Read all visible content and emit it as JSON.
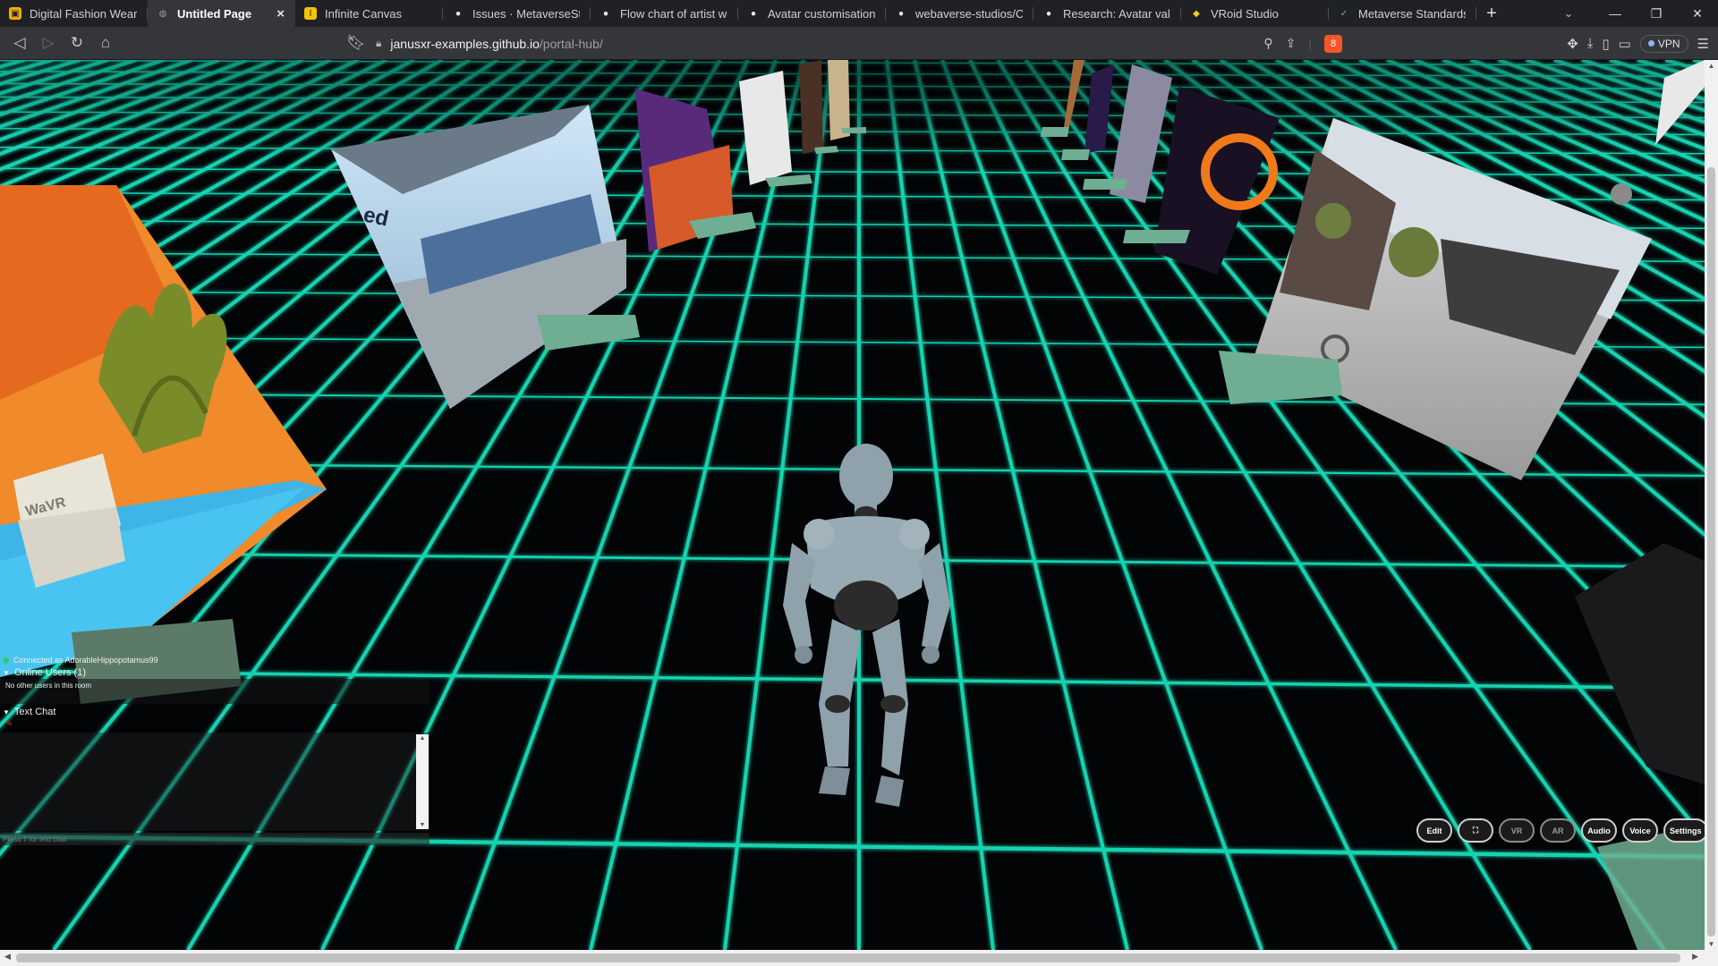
{
  "browser": {
    "tabs": [
      {
        "title": "Digital Fashion Wearabl",
        "icon": "bookmark-app-icon",
        "color": "#f9ab00",
        "active": false
      },
      {
        "title": "Untitled Page",
        "icon": "globe-icon",
        "color": "#9aa0a6",
        "active": true
      },
      {
        "title": "Infinite Canvas",
        "icon": "canvas-icon",
        "color": "#f4c20d",
        "active": false
      },
      {
        "title": "Issues · MetaverseStand",
        "icon": "github-icon",
        "color": "#ffffff",
        "active": false
      },
      {
        "title": "Flow chart of artist work",
        "icon": "github-icon",
        "color": "#ffffff",
        "active": false
      },
      {
        "title": "Avatar customisation: us",
        "icon": "github-icon",
        "color": "#ffffff",
        "active": false
      },
      {
        "title": "webaverse-studios/Char",
        "icon": "github-icon",
        "color": "#ffffff",
        "active": false
      },
      {
        "title": "Research: Avatar validati",
        "icon": "github-icon",
        "color": "#ffffff",
        "active": false
      },
      {
        "title": "VRoid Studio",
        "icon": "vroid-icon",
        "color": "#f7d20f",
        "active": false
      },
      {
        "title": "Metaverse Standards Fo",
        "icon": "msf-icon",
        "color": "#7cc142",
        "active": false
      }
    ],
    "new_tab": "+",
    "tab_close": "×",
    "url_host": "janusxr-examples.github.io",
    "url_path": "/portal-hub/",
    "vpn_label": "VPN",
    "shield_badge": "8"
  },
  "overlay": {
    "status_text": "Connected as AdorableHippopotamus99",
    "online_users_label": "Online Users (1)",
    "no_users_text": "No other users in this room",
    "text_chat_label": "Text Chat",
    "chat_placeholder": "Press T for text chat"
  },
  "scene_labels": {
    "portal_partial_text": "ed",
    "wavr_text": "WaVR"
  },
  "controls": [
    {
      "label": "Edit",
      "enabled": true
    },
    {
      "label": "⛶",
      "enabled": true
    },
    {
      "label": "VR",
      "enabled": false
    },
    {
      "label": "AR",
      "enabled": false
    },
    {
      "label": "Audio",
      "enabled": true
    },
    {
      "label": "Voice",
      "enabled": true
    },
    {
      "label": "Settings",
      "enabled": true
    }
  ],
  "colors": {
    "grid": "#19d3b0",
    "pad": "#6fae92",
    "avatar": "#8fa1ab"
  }
}
